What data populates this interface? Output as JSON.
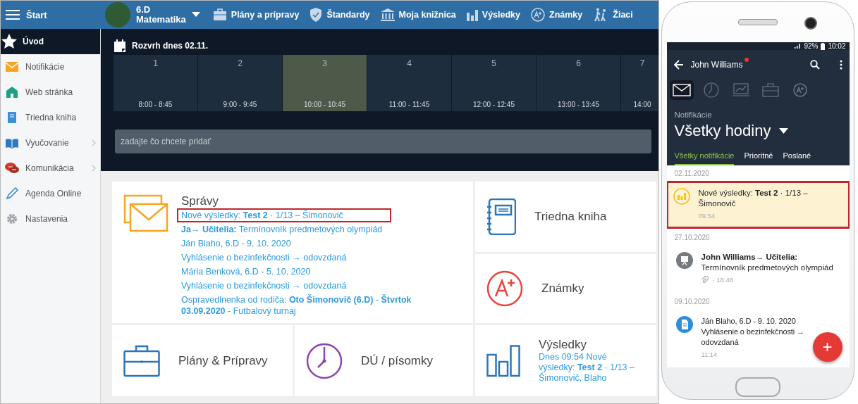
{
  "topbar": {
    "menu_label": "Štart",
    "class_name": "6.D",
    "subject": "Matematika",
    "nav": [
      {
        "label": "Plány a prípravy"
      },
      {
        "label": "Štandardy"
      },
      {
        "label": "Moja knižnica"
      },
      {
        "label": "Výsledky"
      },
      {
        "label": "Známky"
      },
      {
        "label": "Žiaci"
      }
    ]
  },
  "sidebar": {
    "items": [
      {
        "label": "Úvod",
        "selected": true,
        "expandable": false
      },
      {
        "label": "Notifikácie",
        "selected": false,
        "expandable": false
      },
      {
        "label": "Web stránka",
        "selected": false,
        "expandable": false
      },
      {
        "label": "Triedna kniha",
        "selected": false,
        "expandable": false
      },
      {
        "label": "Vyučovanie",
        "selected": false,
        "expandable": true
      },
      {
        "label": "Komunikácia",
        "selected": false,
        "expandable": true
      },
      {
        "label": "Agenda Online",
        "selected": false,
        "expandable": false
      },
      {
        "label": "Nastavenia",
        "selected": false,
        "expandable": false
      }
    ]
  },
  "schedule": {
    "title": "Rozvrh dnes 02.11.",
    "periods": [
      {
        "number": "1",
        "time": "8:00 - 8:45",
        "selected": false
      },
      {
        "number": "2",
        "time": "9:00 - 9:45",
        "selected": false
      },
      {
        "number": "3",
        "time": "10:00 - 10:45",
        "selected": true
      },
      {
        "number": "4",
        "time": "11:00 - 11:45",
        "selected": false
      },
      {
        "number": "5",
        "time": "12:00 - 12:45",
        "selected": false
      },
      {
        "number": "6",
        "time": "13:00 - 13:45",
        "selected": false
      },
      {
        "number": "7",
        "time": "14:00",
        "selected": false
      }
    ],
    "input": {
      "placeholder": "zadajte čo chcete pridať"
    }
  },
  "cards": [
    {
      "kind": "messages",
      "title": "Správy",
      "messages": [
        {
          "text": "Nové výsledky: **Test 2** · 1/13 – Šimonovič",
          "highlighted": true
        },
        {
          "text": "**Ja→ Učitelia:** Termínovník predmetových olympiád",
          "highlighted": false
        },
        {
          "text": "Ján Blaho, 6.D - 9. 10. 2020",
          "highlighted": false
        },
        {
          "text": "Vyhlásenie o bezinfekčnosti → odovzdaná",
          "highlighted": false
        },
        {
          "text": "Mária Benková, 6.D - 5. 10. 2020",
          "highlighted": false
        },
        {
          "text": "Vyhlásenie o bezinfekčnosti → odovzdaná",
          "highlighted": false
        },
        {
          "text": "Ospravedlnenka od rodiča: **Oto Šimonovič (6.D)** - **Štvrtok 03.09.2020** - Futbalový turnaj",
          "highlighted": false
        }
      ]
    },
    {
      "kind": "tile",
      "title": "Triedna kniha"
    },
    {
      "kind": "tile",
      "title": "Známky"
    },
    {
      "kind": "tile",
      "title": "Plány & Prípravy"
    },
    {
      "kind": "tile",
      "title": "DÚ / písomky"
    },
    {
      "kind": "tile",
      "title": "Výsledky",
      "subtitle": "Dnes 09:54 Nové výsledky: **Test 2** · 1/13 – Šimonovič, Blaho"
    }
  ],
  "phone": {
    "battery": "92%",
    "time": "10:02",
    "user": "John Williams",
    "user_unread": true,
    "icon_tabs": [
      {
        "selected": true
      },
      {
        "selected": false
      },
      {
        "selected": false
      },
      {
        "selected": false
      },
      {
        "selected": false
      }
    ],
    "section": "Notifikácie",
    "title": "Všetky hodiny",
    "filters": [
      {
        "label": "Všetky notifikácie",
        "selected": true
      },
      {
        "label": "Prioritné",
        "selected": false
      },
      {
        "label": "Poslané",
        "selected": false
      }
    ],
    "groups": [
      {
        "date": "02.11.2020",
        "items": [
          {
            "kind": "results",
            "text": "Nové výsledky: **Test 2** · 1/13 – Šimonovič",
            "time": "09:54",
            "attachment": false,
            "highlighted": true
          }
        ]
      },
      {
        "date": "27.10.2020",
        "items": [
          {
            "kind": "presentation",
            "text": "**John Williams→ Učitelia:** Termínovník predmetových olympiád",
            "time": "· 18:48",
            "attachment": true,
            "highlighted": false
          }
        ]
      },
      {
        "date": "09.10.2020",
        "items": [
          {
            "kind": "document",
            "text": "Ján Blaho, 6.D - 9. 10. 2020 Vyhlásenie o bezinfekčnosti → odovzdaná",
            "time": "11:14",
            "attachment": false,
            "highlighted": false
          }
        ]
      }
    ],
    "fab": "+"
  }
}
